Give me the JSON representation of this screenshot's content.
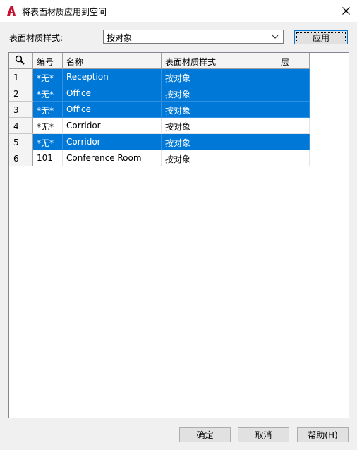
{
  "window": {
    "title": "将表面材质应用到空间",
    "close_glyph": "✕"
  },
  "style_row": {
    "label": "表面材质样式:",
    "selected": "按对象",
    "apply_label": "应用"
  },
  "grid": {
    "columns": [
      "编号",
      "名称",
      "表面材质样式",
      "层"
    ],
    "rows": [
      {
        "index": "1",
        "number": "*无*",
        "name": "Reception",
        "style": "按对象",
        "layer": "",
        "selected": true
      },
      {
        "index": "2",
        "number": "*无*",
        "name": "Office",
        "style": "按对象",
        "layer": "",
        "selected": true
      },
      {
        "index": "3",
        "number": "*无*",
        "name": "Office",
        "style": "按对象",
        "layer": "",
        "selected": true
      },
      {
        "index": "4",
        "number": "*无*",
        "name": "Corridor",
        "style": "按对象",
        "layer": "",
        "selected": false
      },
      {
        "index": "5",
        "number": "*无*",
        "name": "Corridor",
        "style": "按对象",
        "layer": "",
        "selected": true
      },
      {
        "index": "6",
        "number": "101",
        "name": "Conference Room",
        "style": "按对象",
        "layer": "",
        "selected": false
      }
    ]
  },
  "footer": {
    "ok_label": "确定",
    "cancel_label": "取消",
    "help_label": "帮助(H)"
  },
  "colors": {
    "selection": "#0078d7",
    "app_icon": "#c8102e"
  }
}
